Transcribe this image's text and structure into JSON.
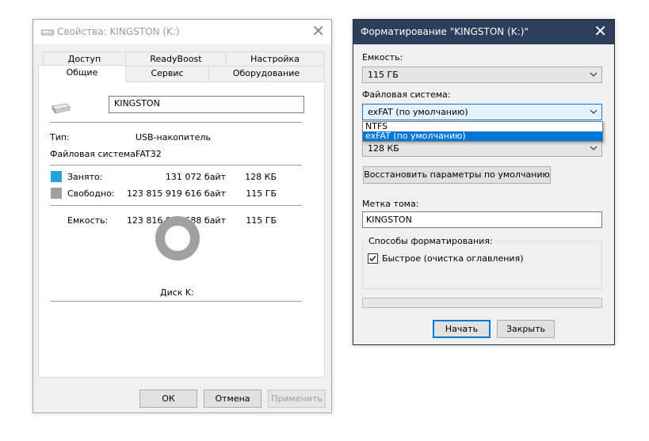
{
  "props": {
    "title": "Свойства: KINGSTON (K:)",
    "tabs_row1": [
      "Доступ",
      "ReadyBoost",
      "Настройка"
    ],
    "tabs_row2": [
      "Общие",
      "Сервис",
      "Оборудование"
    ],
    "volume_name": "KINGSTON",
    "type_label": "Тип:",
    "type_value": "USB-накопитель",
    "fs_label": "Файловая система:",
    "fs_value": "FAT32",
    "used_label": "Занято:",
    "used_bytes": "131 072 байт",
    "used_short": "128 КБ",
    "free_label": "Свободно:",
    "free_bytes": "123 815 919 616 байт",
    "free_short": "115 ГБ",
    "capacity_label": "Емкость:",
    "capacity_bytes": "123 816 050 688 байт",
    "capacity_short": "115 ГБ",
    "disk_label": "Диск K:",
    "ok_label": "ОК",
    "cancel_label": "Отмена",
    "apply_label": "Применить",
    "used_color": "#26a0da",
    "free_color": "#a0a0a0"
  },
  "format": {
    "title": "Форматирование \"KINGSTON (K:)\"",
    "capacity_label": "Емкость:",
    "capacity_value": "115 ГБ",
    "fs_label": "Файловая система:",
    "fs_value": "exFAT (по умолчанию)",
    "fs_options": [
      "NTFS",
      "exFAT (по умолчанию)"
    ],
    "cluster_value": "128 КБ",
    "restore_label": "Восстановить параметры по умолчанию",
    "volume_label_caption": "Метка тома:",
    "volume_label_value": "KINGSTON",
    "methods_label": "Способы форматирования:",
    "quick_label": "Быстрое (очистка оглавления)",
    "quick_checked": true,
    "start_label": "Начать",
    "close_label": "Закрыть",
    "accent_color": "#0078d7",
    "titlebar_color": "#2b3e5c"
  }
}
